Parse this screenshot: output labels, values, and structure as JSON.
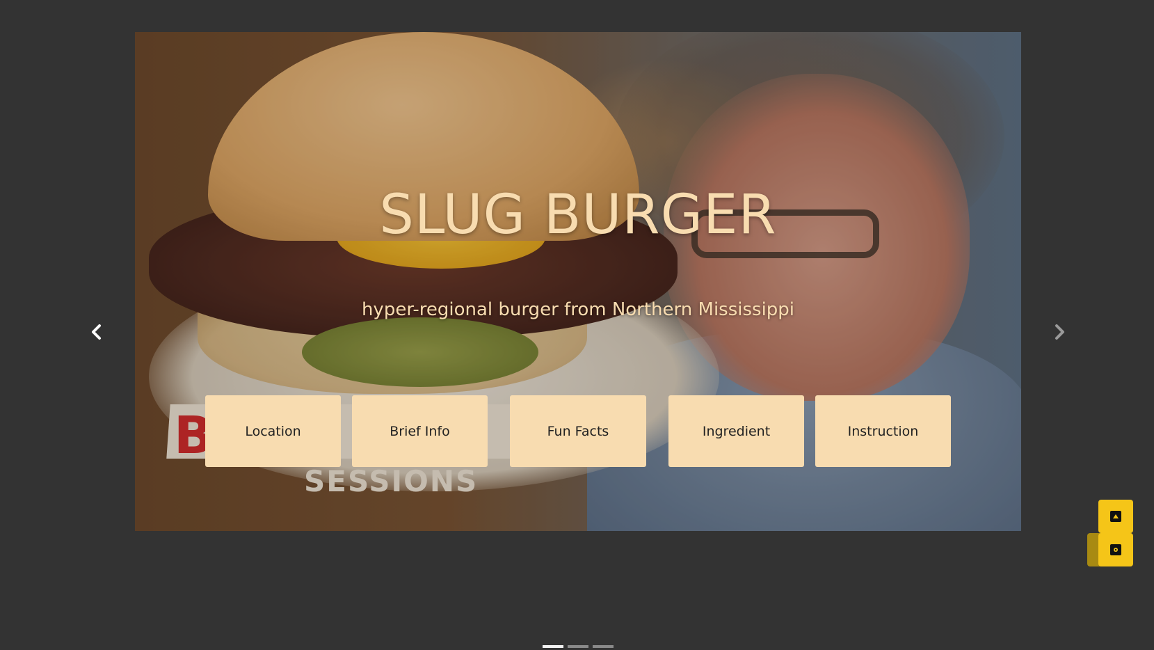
{
  "hero": {
    "title": "SLUG BURGER",
    "subtitle": "hyper-regional burger from Northern Mississippi",
    "background_image": "burger-and-chef-photo",
    "logo_text": "SESSIONS",
    "logo_red_letter": "B"
  },
  "menu": {
    "buttons": [
      {
        "label": "Location"
      },
      {
        "label": "Brief Info"
      },
      {
        "label": "Fun Facts"
      },
      {
        "label": "Ingredient"
      },
      {
        "label": "Instruction"
      }
    ]
  },
  "carousel": {
    "prev_icon": "chevron-left-icon",
    "next_icon": "chevron-right-icon",
    "slides_count": 3,
    "active_index": 0
  },
  "floating_actions": {
    "top_icon": "arrow-up-icon",
    "bottom_icon": "settings-icon",
    "accent_color": "#f5c518"
  },
  "colors": {
    "page_background": "#333333",
    "button_background": "#f8dcb0",
    "title_color": "#f8dcb0"
  }
}
